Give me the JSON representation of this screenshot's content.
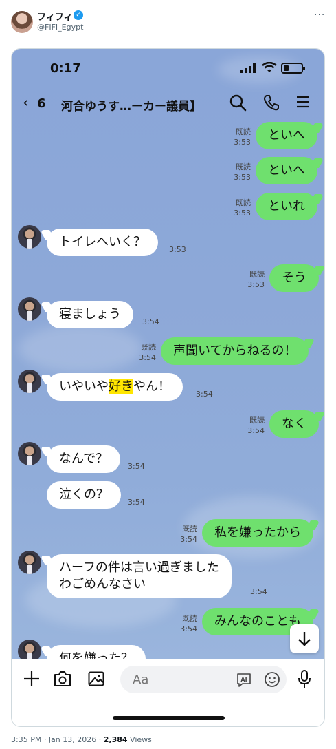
{
  "tweet": {
    "display_name": "フィフィ",
    "handle": "@FIFI_Egypt",
    "timestamp": "3:35 PM · Jan 13, 2026 · ",
    "views_count": "2,384",
    "views_label": "Views"
  },
  "phone": {
    "status_time": "0:17",
    "battery_level": 0.3
  },
  "chat_header": {
    "back_count": "6",
    "title": "河合ゆうす…ーカー議員】"
  },
  "messages": [
    {
      "dir": "out",
      "text": "といへ",
      "read": "既読",
      "time": "3:53"
    },
    {
      "dir": "out",
      "text": "といへ",
      "read": "既読",
      "time": "3:53"
    },
    {
      "dir": "out",
      "text": "といれ",
      "read": "既読",
      "time": "3:53"
    },
    {
      "dir": "in",
      "text": "トイレへいく？",
      "time": "3:53"
    },
    {
      "dir": "out",
      "text": "そう",
      "read": "既読",
      "time": "3:53"
    },
    {
      "dir": "in",
      "text": "寝ましょう",
      "time": "3:54"
    },
    {
      "dir": "out",
      "text": "声聞いてからねるの！",
      "read": "既読",
      "time": "3:54"
    },
    {
      "dir": "in",
      "text_before": "いやいや",
      "text_highlight": "好き",
      "text_after": "やん！",
      "time": "3:54"
    },
    {
      "dir": "out",
      "text": "なく",
      "read": "既読",
      "time": "3:54"
    },
    {
      "dir": "in",
      "text": "なんで？",
      "time": "3:54"
    },
    {
      "dir": "in",
      "text": "泣くの？",
      "time": "3:54"
    },
    {
      "dir": "out",
      "text": "私を嫌ったから",
      "read": "既読",
      "time": "3:54"
    },
    {
      "dir": "in",
      "line1": "ハーフの件は言い過ぎました",
      "line2": "わごめんなさい",
      "time": "3:54"
    },
    {
      "dir": "out",
      "text": "みんなのことも",
      "read": "既読",
      "time": "3:54"
    },
    {
      "dir": "in",
      "text": "何を嫌った？"
    }
  ],
  "input": {
    "placeholder": "Aa"
  },
  "icons": [
    "back-icon",
    "search-icon",
    "phone-call-icon",
    "menu-icon",
    "plus-icon",
    "camera-icon",
    "image-icon",
    "ai-icon",
    "emoji-icon",
    "mic-icon",
    "arrow-down-icon",
    "verified-icon",
    "more-icon"
  ],
  "colors": {
    "outgoing_bubble": "#6fe06e",
    "incoming_bubble": "#ffffff",
    "chat_background": "#8da8d8",
    "highlight": "#ffe600",
    "verified": "#1d9bf0"
  }
}
